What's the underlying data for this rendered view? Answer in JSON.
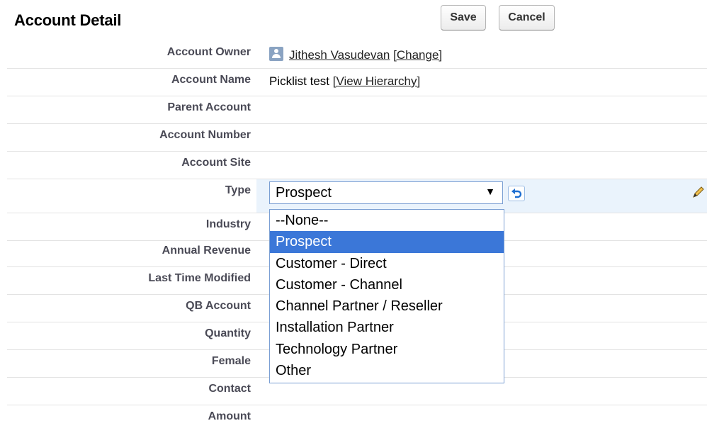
{
  "header": {
    "title": "Account Detail",
    "save_label": "Save",
    "cancel_label": "Cancel"
  },
  "fields": {
    "account_owner": {
      "label": "Account Owner",
      "name": "Jithesh Vasudevan",
      "change_link": "[Change]"
    },
    "account_name": {
      "label": "Account Name",
      "value": "Picklist test",
      "hierarchy_link": "[View Hierarchy]"
    },
    "parent_account": {
      "label": "Parent Account"
    },
    "account_number": {
      "label": "Account Number"
    },
    "account_site": {
      "label": "Account Site"
    },
    "type": {
      "label": "Type",
      "selected": "Prospect"
    },
    "industry": {
      "label": "Industry"
    },
    "annual_revenue": {
      "label": "Annual Revenue"
    },
    "last_time_modified": {
      "label": "Last Time Modified"
    },
    "qb_account": {
      "label": "QB Account"
    },
    "quantity": {
      "label": "Quantity"
    },
    "female": {
      "label": "Female"
    },
    "contact": {
      "label": "Contact"
    },
    "amount": {
      "label": "Amount"
    }
  },
  "type_options": [
    "--None--",
    "Prospect",
    "Customer - Direct",
    "Customer - Channel",
    "Channel Partner / Reseller",
    "Installation Partner",
    "Technology Partner",
    "Other"
  ],
  "colors": {
    "selected_option_bg": "#3b77d8",
    "edit_row_bg": "#eaf3fc",
    "label_text": "#4a4a56"
  },
  "icons": {
    "owner": "user-avatar-icon",
    "dropdown": "dropdown-arrow-icon",
    "undo": "undo-icon",
    "edit": "pencil-icon"
  }
}
